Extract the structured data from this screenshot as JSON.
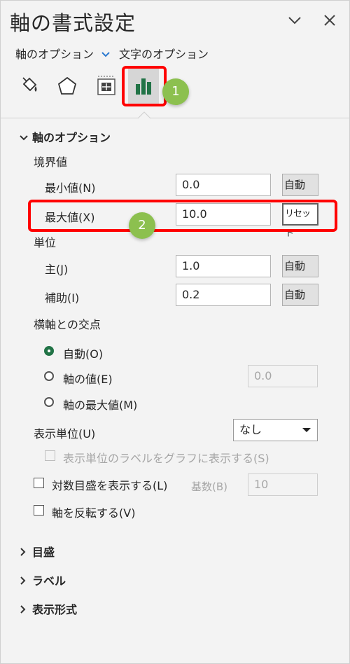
{
  "pane": {
    "title": "軸の書式設定",
    "collapse_icon": "chevron-down-icon",
    "close_icon": "close-icon"
  },
  "subtabs": {
    "axis_options": "軸のオプション",
    "text_options": "文字のオプション"
  },
  "icon_tabs": [
    "fill-line-icon",
    "effects-pentagon-icon",
    "size-properties-icon",
    "bar-chart-icon"
  ],
  "section": {
    "title": "軸のオプション",
    "bounds_label": "境界値",
    "min": {
      "label": "最小値(N)",
      "value": "0.0",
      "button": "自動"
    },
    "max": {
      "label": "最大値(X)",
      "value": "10.0",
      "button": "リセット"
    },
    "units_label": "単位",
    "major": {
      "label": "主(J)",
      "value": "1.0",
      "button": "自動"
    },
    "minor": {
      "label": "補助(I)",
      "value": "0.2",
      "button": "自動"
    },
    "crosses_label": "横軸との交点",
    "crosses_options": [
      {
        "label": "自動(O)",
        "selected": true
      },
      {
        "label": "軸の値(E)",
        "selected": false,
        "value": "0.0"
      },
      {
        "label": "軸の最大値(M)",
        "selected": false
      }
    ],
    "display_units_label": "表示単位(U)",
    "display_units_value": "なし",
    "show_units_label": "表示単位のラベルをグラフに表示する(S)",
    "log_scale_label": "対数目盛を表示する(L)",
    "base_label": "基数(B)",
    "base_value": "10",
    "reverse_label": "軸を反転する(V)"
  },
  "collapsed_sections": [
    "目盛",
    "ラベル",
    "表示形式"
  ],
  "annotations": {
    "badge1": "1",
    "badge2": "2",
    "highlight_color": "#ff0000",
    "badge_color": "#8cc04f",
    "accent_green": "#217346"
  }
}
